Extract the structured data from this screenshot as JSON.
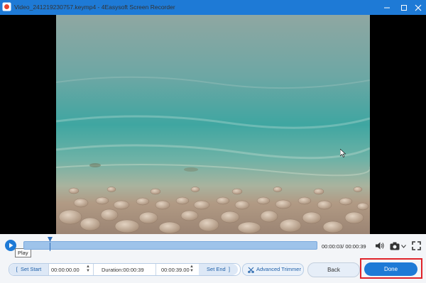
{
  "window": {
    "title": "Video_241219230757.keymp4 - 4Easysoft Screen Recorder",
    "icons": {
      "app": "app-icon",
      "minimize": "minimize-icon",
      "maximize": "maximize-icon",
      "close": "close-icon"
    }
  },
  "player": {
    "play_tooltip": "Play",
    "progress_fraction": 0.09,
    "time_readout": "00:00:03/ 00:00:39"
  },
  "trim": {
    "set_start_label": "Set Start",
    "start_time": "00:00:00.00",
    "duration_label": "Duration:00:00:39",
    "end_time": "00:00:39.00",
    "set_end_label": "Set End",
    "advanced_trimmer_label": "Advanced Trimmer"
  },
  "actions": {
    "back_label": "Back",
    "done_label": "Done"
  },
  "colors": {
    "accent": "#1e7ad6",
    "highlight_border": "#e0242a",
    "title_bar": "#1e7ad6"
  }
}
